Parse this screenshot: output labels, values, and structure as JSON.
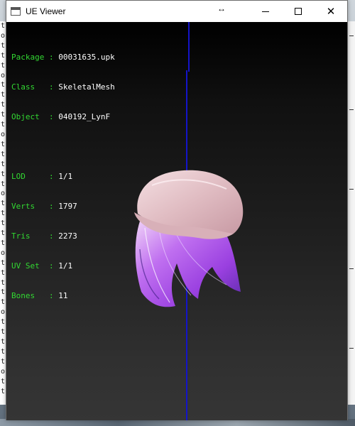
{
  "window": {
    "title": "UE Viewer",
    "resize_glyph": "↔",
    "close_glyph": "✕"
  },
  "info_panel": {
    "asset": [
      {
        "label": "Package",
        "value": "00031635.upk"
      },
      {
        "label": "Class  ",
        "value": "SkeletalMesh"
      },
      {
        "label": "Object ",
        "value": "040192_LynF"
      }
    ],
    "stats": [
      {
        "label": "LOD    ",
        "value": "1/1"
      },
      {
        "label": "Verts  ",
        "value": "1797"
      },
      {
        "label": "Tris   ",
        "value": "2273"
      },
      {
        "label": "UV Set ",
        "value": "1/1"
      },
      {
        "label": "Bones  ",
        "value": "11"
      }
    ],
    "separator": " : "
  },
  "background_console": {
    "chars": [
      "t",
      "o",
      "t",
      "t",
      "t",
      "o",
      "t",
      "t",
      "t",
      "t",
      "t",
      "o",
      "t",
      "t",
      "t",
      "t",
      "t",
      "o",
      "t",
      "t",
      "t",
      "t",
      "t",
      "o",
      "t",
      "t",
      "t",
      "t",
      "t",
      "o",
      "t",
      "t",
      "t",
      "t",
      "t",
      "o",
      "t",
      "t"
    ]
  },
  "colors": {
    "label_green": "#32d832",
    "value_white": "#ffffff",
    "axis_blue": "#1414c8",
    "hat_pink": "#e8c8cc",
    "hair_purple": "#9a40e0"
  },
  "icons": [
    "app-icon",
    "resize-icon",
    "minimize-icon",
    "maximize-icon",
    "close-icon"
  ]
}
